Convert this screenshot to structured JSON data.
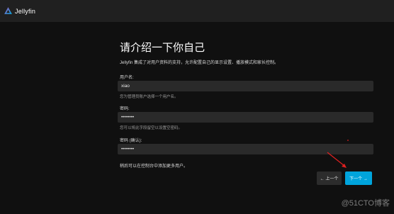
{
  "app": {
    "brand_name": "Jellyfin",
    "logo_icon": "jellyfin-logo-icon",
    "accent_color": "#00a4dc"
  },
  "page": {
    "title": "请介绍一下你自己",
    "intro": "Jellyfin 集成了对用户资料的支持，允许配置自己的显示设置、播放模式和家长控制。"
  },
  "form": {
    "username": {
      "label": "用户名:",
      "value": "xiao",
      "help": "您为管理员账户选择一个用户名。"
    },
    "password": {
      "label": "密码:",
      "value": "••••••••",
      "help": "您可以将此字段留空以设置空密码。"
    },
    "password_confirm": {
      "label": "密码 (确认):",
      "value": "••••••••"
    }
  },
  "footer": {
    "note": "稍后可以在控制台中添加更多用户。",
    "prev_label": "← 上一个",
    "next_label": "下一个 →"
  },
  "watermark": {
    "text": "@51CTO博客"
  }
}
